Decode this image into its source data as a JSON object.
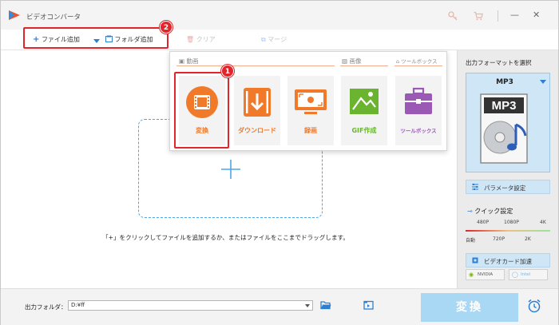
{
  "window": {
    "title": "ビデオコンバータ"
  },
  "titlebar": {
    "icons": [
      "key-icon",
      "cart-icon"
    ],
    "minimize": "—",
    "close": "✕"
  },
  "toolbar": {
    "add_file": "ファイル追加",
    "add_folder": "フォルダ追加",
    "clear": "クリア",
    "merge": "マージ"
  },
  "markers": {
    "step1": "1",
    "step2": "2"
  },
  "popup": {
    "sections": {
      "video": "動画",
      "image": "画像",
      "toolbox": "ツールボックス"
    },
    "tiles": [
      {
        "label": "変換",
        "icon": "film-icon",
        "color": "#f07a2a"
      },
      {
        "label": "ダウンロード",
        "icon": "download-icon",
        "color": "#f07a2a"
      },
      {
        "label": "録画",
        "icon": "screen-record-icon",
        "color": "#f07a2a"
      },
      {
        "label": "GIF作成",
        "icon": "image-icon",
        "color": "#6ab42f"
      },
      {
        "label": "ツールボックス",
        "icon": "toolbox-icon",
        "color": "#9b59b6"
      }
    ]
  },
  "main": {
    "hint": "「+」をクリックしてファイルを追加するか、またはファイルをここまでドラッグします。"
  },
  "right_panel": {
    "title": "出力フォーマットを選択",
    "format": "MP3",
    "format_art_label": "MP3",
    "params_button": "パラメータ設定",
    "quick_title": "クイック設定",
    "quality_top": [
      "480P",
      "1080P",
      "4K"
    ],
    "quality_bottom": [
      "自動",
      "720P",
      "2K"
    ],
    "gpu_title": "ビデオカード加速",
    "gpu_nvidia": "NVIDIA",
    "gpu_intel": "Intel"
  },
  "bottom": {
    "output_label": "出力フォルダ：",
    "output_path": "D:¥ff",
    "convert_button": "変換"
  },
  "colors": {
    "accent_red": "#e0262a",
    "orange": "#f07a2a",
    "blue": "#2e7fd0",
    "convert_disabled": "#a9d8f5"
  }
}
